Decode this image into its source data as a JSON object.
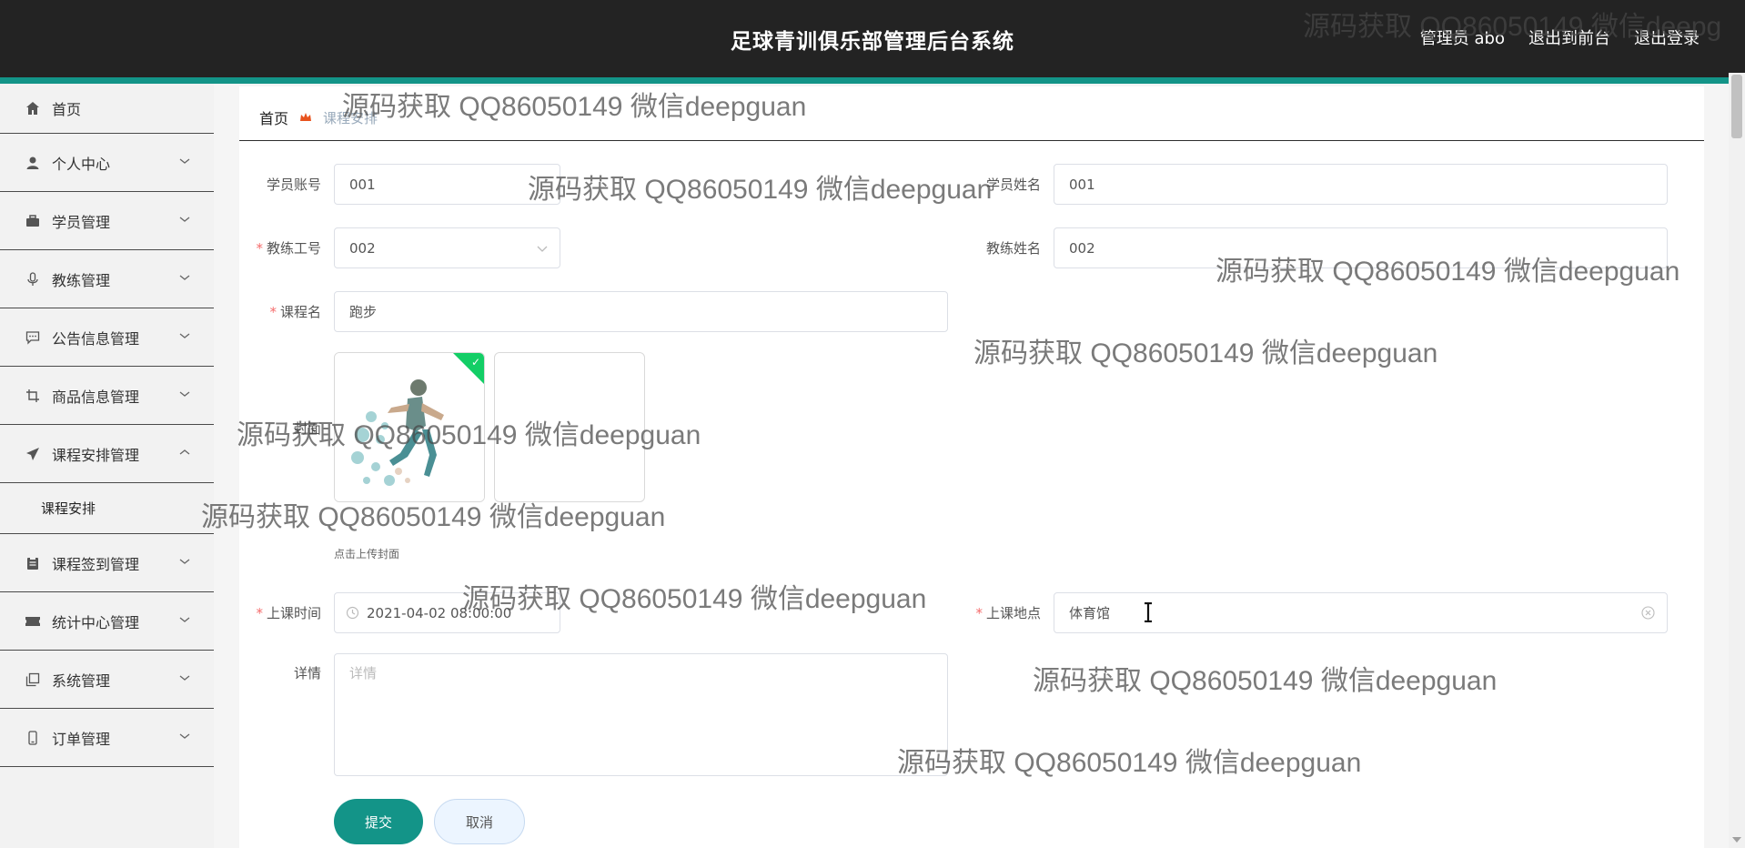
{
  "header": {
    "title": "足球青训俱乐部管理后台系统",
    "user_label": "管理员 abo",
    "to_front_label": "退出到前台",
    "logout_label": "退出登录"
  },
  "sidebar": {
    "items": [
      {
        "label": "首页",
        "icon": "home-icon"
      },
      {
        "label": "个人中心",
        "icon": "user-icon"
      },
      {
        "label": "学员管理",
        "icon": "briefcase-icon"
      },
      {
        "label": "教练管理",
        "icon": "microphone-icon"
      },
      {
        "label": "公告信息管理",
        "icon": "message-icon"
      },
      {
        "label": "商品信息管理",
        "icon": "crop-icon"
      },
      {
        "label": "课程安排管理",
        "icon": "send-icon"
      },
      {
        "label": "课程签到管理",
        "icon": "clipboard-icon"
      },
      {
        "label": "统计中心管理",
        "icon": "ticket-icon"
      },
      {
        "label": "系统管理",
        "icon": "copy-icon"
      },
      {
        "label": "订单管理",
        "icon": "mobile-icon"
      }
    ],
    "submenu": {
      "label": "课程安排"
    }
  },
  "breadcrumb": {
    "home": "首页",
    "current": "课程安排"
  },
  "form": {
    "student_account": {
      "label": "学员账号",
      "value": "001"
    },
    "student_name": {
      "label": "学员姓名",
      "value": "001"
    },
    "coach_id": {
      "label": "教练工号",
      "value": "002"
    },
    "coach_name": {
      "label": "教练姓名",
      "value": "002"
    },
    "course_name": {
      "label": "课程名",
      "value": "跑步"
    },
    "cover": {
      "label": "封面",
      "hint": "点击上传封面"
    },
    "class_time": {
      "label": "上课时间",
      "value": "2021-04-02 08:00:00"
    },
    "location": {
      "label": "上课地点",
      "value": "体育馆"
    },
    "details": {
      "label": "详情",
      "placeholder": "详情"
    },
    "submit_label": "提交",
    "cancel_label": "取消"
  },
  "watermark": {
    "text": "源码获取 QQ86050149 微信deepguan",
    "text_cut": "源码获取 QQ86050149 微信deepg"
  },
  "colors": {
    "header_bg": "#232323",
    "accent": "#139488",
    "required": "#f56c6c",
    "upload_success": "#13ce66"
  }
}
